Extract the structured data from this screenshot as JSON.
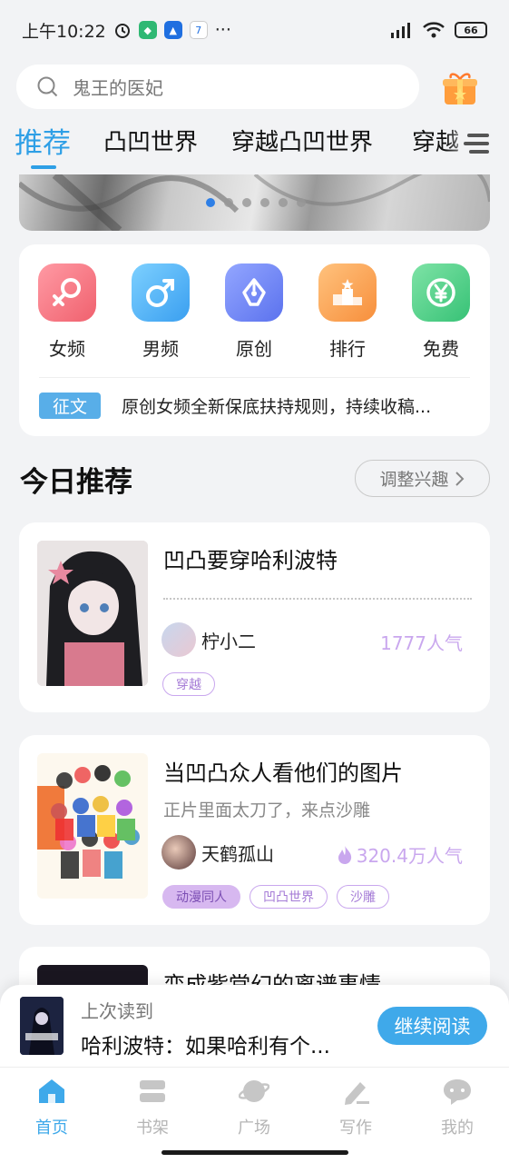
{
  "status_bar": {
    "time": "上午10:22",
    "more": "···",
    "battery": "66"
  },
  "search": {
    "placeholder": "鬼王的医妃"
  },
  "tabs": [
    "推荐",
    "凸凹世界",
    "穿越凸凹世界",
    "穿越"
  ],
  "banner": {
    "dots": 6,
    "active_dot": 0
  },
  "categories": [
    {
      "label": "女频",
      "icon": "female-icon",
      "color": "#f47a85"
    },
    {
      "label": "男频",
      "icon": "male-icon",
      "color": "#4fb4f0"
    },
    {
      "label": "原创",
      "icon": "pen-nib-icon",
      "color": "#6f86f0"
    },
    {
      "label": "排行",
      "icon": "podium-icon",
      "color": "#f7a85a"
    },
    {
      "label": "免费",
      "icon": "yen-icon",
      "color": "#4fcf84"
    }
  ],
  "notice": {
    "tag": "征文",
    "text": "原创女频全新保底扶持规则，持续收稿..."
  },
  "section": {
    "title": "今日推荐",
    "adjust_label": "调整兴趣"
  },
  "books": [
    {
      "title": "凹凸要穿哈利波特",
      "desc": "",
      "author": "柠小二",
      "popularity": "1777人气",
      "hot": false,
      "tags": [
        {
          "label": "穿越",
          "filled": false
        }
      ]
    },
    {
      "title": "当凹凸众人看他们的图片",
      "desc": "正片里面太刀了，来点沙雕",
      "author": "天鹤孤山",
      "popularity": "320.4万人气",
      "hot": true,
      "tags": [
        {
          "label": "动漫同人",
          "filled": true
        },
        {
          "label": "凹凸世界",
          "filled": false
        },
        {
          "label": "沙雕",
          "filled": false
        }
      ]
    },
    {
      "title": "变成紫堂幻的离谱事情"
    }
  ],
  "continue_reading": {
    "last_label": "上次读到",
    "book_title": "哈利波特：如果哈利有个...",
    "button": "继续阅读"
  },
  "nav": [
    {
      "label": "首页",
      "icon": "home-icon",
      "active": true
    },
    {
      "label": "书架",
      "icon": "bookshelf-icon",
      "active": false
    },
    {
      "label": "广场",
      "icon": "planet-icon",
      "active": false
    },
    {
      "label": "写作",
      "icon": "write-icon",
      "active": false
    },
    {
      "label": "我的",
      "icon": "chat-bubble-icon",
      "active": false
    }
  ],
  "colors": {
    "accent": "#2e9fe6",
    "popularity": "#c9a7ee",
    "tag_fill": "#d7b8f0"
  }
}
